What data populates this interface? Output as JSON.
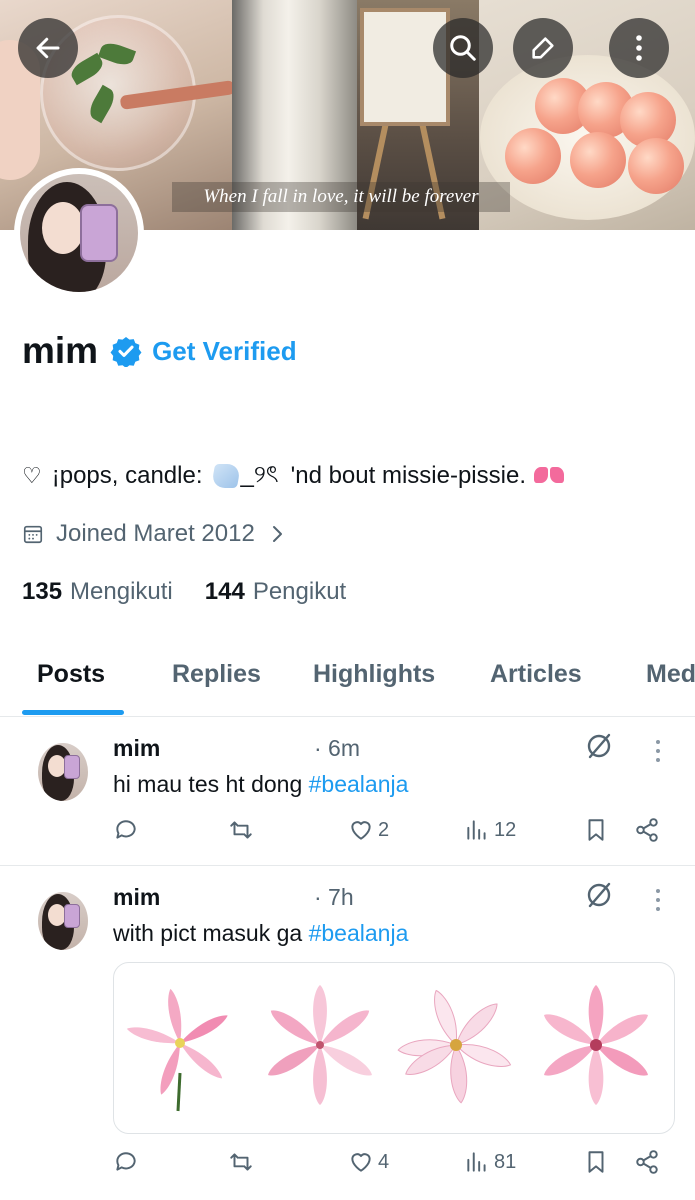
{
  "banner": {
    "caption": "When I fall in love, it will be forever"
  },
  "profile": {
    "name": "mim",
    "get_verified": "Get Verified",
    "bio_heart": "♡",
    "bio_part1": "¡pops, candle:",
    "bio_part2": "_୨ৎ",
    "bio_part3": "'nd bout missie-pissie.",
    "joined": "Joined Maret 2012",
    "following_count": "135",
    "following_label": "Mengikuti",
    "followers_count": "144",
    "followers_label": "Pengikut"
  },
  "tabs": [
    {
      "label": "Posts",
      "active": true
    },
    {
      "label": "Replies"
    },
    {
      "label": "Highlights"
    },
    {
      "label": "Articles"
    },
    {
      "label": "Med"
    }
  ],
  "posts": [
    {
      "name": "mim",
      "time": "· 6m",
      "text": "hi mau tes ht dong ",
      "hashtag": "#bealanja",
      "likes": "2",
      "views": "12"
    },
    {
      "name": "mim",
      "time": "· 7h",
      "text": "with pict masuk ga ",
      "hashtag": "#bealanja",
      "likes": "4",
      "views": "81"
    }
  ],
  "colors": {
    "accent": "#1d9bf0",
    "text": "#0f1419",
    "secondary": "#536471"
  },
  "icons": {
    "back": "arrow-left-icon",
    "search": "search-icon",
    "edit": "pencil-icon",
    "more": "more-vertical-icon",
    "verified": "verified-badge-icon",
    "calendar": "calendar-icon",
    "reply": "reply-icon",
    "repost": "repost-icon",
    "like": "heart-icon",
    "views": "views-icon",
    "bookmark": "bookmark-icon",
    "share": "share-icon",
    "grok": "grok-icon"
  }
}
